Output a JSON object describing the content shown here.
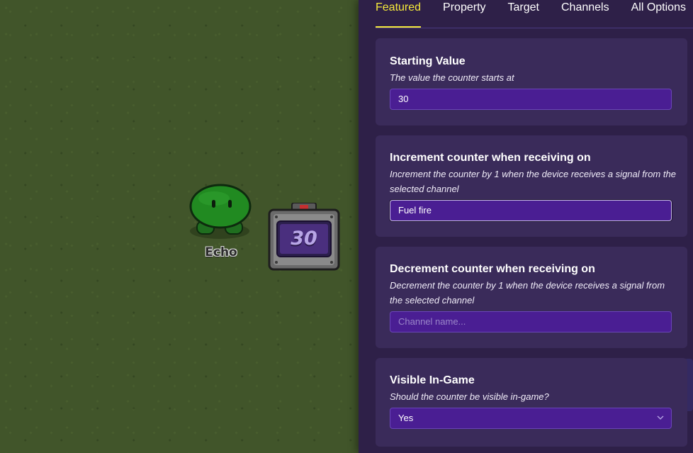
{
  "game": {
    "player_name": "Echo",
    "counter_value": "30"
  },
  "panel": {
    "tabs": [
      {
        "label": "Featured",
        "active": true
      },
      {
        "label": "Property",
        "active": false
      },
      {
        "label": "Target",
        "active": false
      },
      {
        "label": "Channels",
        "active": false
      },
      {
        "label": "All Options",
        "active": false
      }
    ],
    "starting_value": {
      "title": "Starting Value",
      "description": "The value the counter starts at",
      "value": "30"
    },
    "increment": {
      "title": "Increment counter when receiving on",
      "description": "Increment the counter by 1 when the device receives a signal from the selected channel",
      "value": "Fuel fire"
    },
    "decrement": {
      "title": "Decrement counter when receiving on",
      "description": "Decrement the counter by 1 when the device receives a signal from the selected channel",
      "placeholder": "Channel name..."
    },
    "visible": {
      "title": "Visible In-Game",
      "description": "Should the counter be visible in-game?",
      "value": "Yes"
    }
  },
  "colors": {
    "accent": "#f5e93a",
    "panel_bg": "#2e2048",
    "card_bg": "#3a2b5a",
    "field_bg": "#4a1e93",
    "grass": "#41552a"
  }
}
